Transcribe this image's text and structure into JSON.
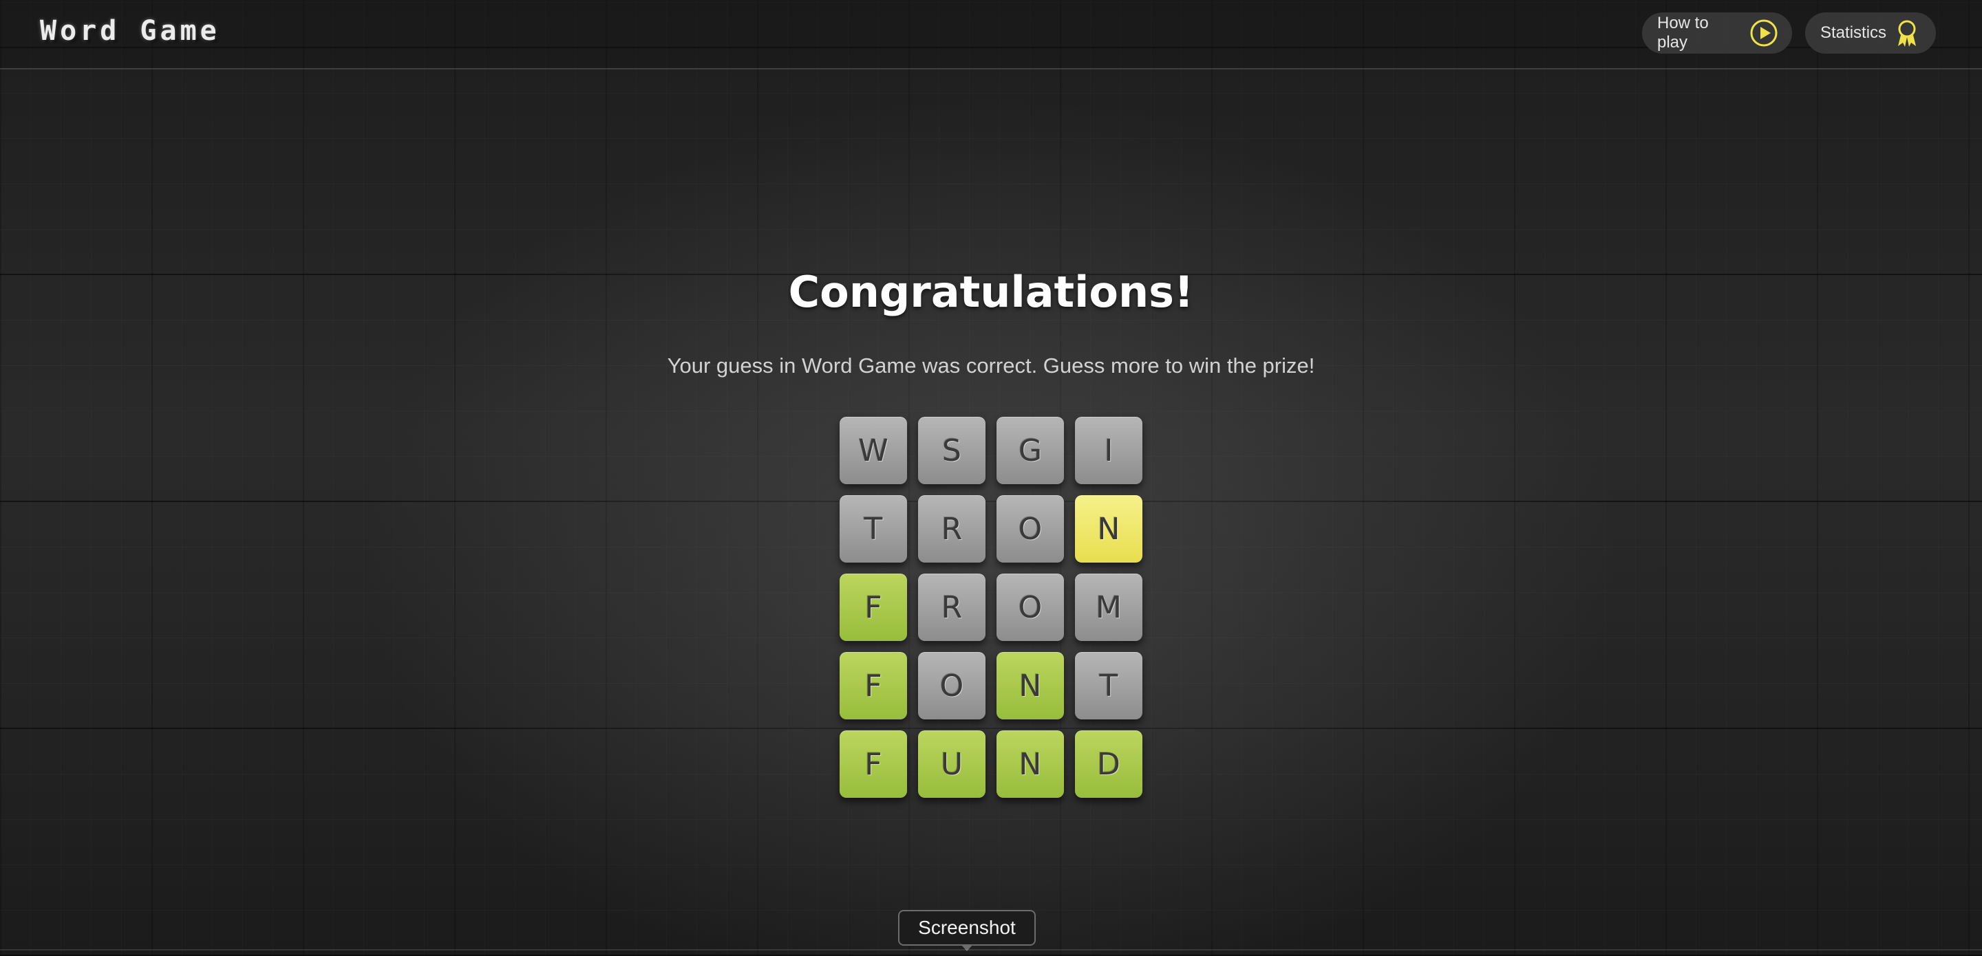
{
  "header": {
    "title": "Word Game",
    "how_to_play_label": "How to play",
    "how_to_play_icon": "play-circle-icon",
    "statistics_label": "Statistics",
    "statistics_icon": "award-ribbon-icon"
  },
  "colors": {
    "accent_yellow": "#f0e34a",
    "tile_gray": "#a0a0a0",
    "tile_yellow": "#efe96b",
    "tile_green": "#aac84c"
  },
  "result": {
    "title": "Congratulations!",
    "message": "Your guess in Word Game was correct. Guess more to win the prize!"
  },
  "board": {
    "rows": [
      [
        {
          "letter": "W",
          "state": "absent"
        },
        {
          "letter": "S",
          "state": "absent"
        },
        {
          "letter": "G",
          "state": "absent"
        },
        {
          "letter": "I",
          "state": "absent"
        }
      ],
      [
        {
          "letter": "T",
          "state": "absent"
        },
        {
          "letter": "R",
          "state": "absent"
        },
        {
          "letter": "O",
          "state": "absent"
        },
        {
          "letter": "N",
          "state": "present"
        }
      ],
      [
        {
          "letter": "F",
          "state": "correct"
        },
        {
          "letter": "R",
          "state": "absent"
        },
        {
          "letter": "O",
          "state": "absent"
        },
        {
          "letter": "M",
          "state": "absent"
        }
      ],
      [
        {
          "letter": "F",
          "state": "correct"
        },
        {
          "letter": "O",
          "state": "absent"
        },
        {
          "letter": "N",
          "state": "correct"
        },
        {
          "letter": "T",
          "state": "absent"
        }
      ],
      [
        {
          "letter": "F",
          "state": "correct"
        },
        {
          "letter": "U",
          "state": "correct"
        },
        {
          "letter": "N",
          "state": "correct"
        },
        {
          "letter": "D",
          "state": "correct"
        }
      ]
    ]
  },
  "tooltip": {
    "label": "Screenshot"
  }
}
